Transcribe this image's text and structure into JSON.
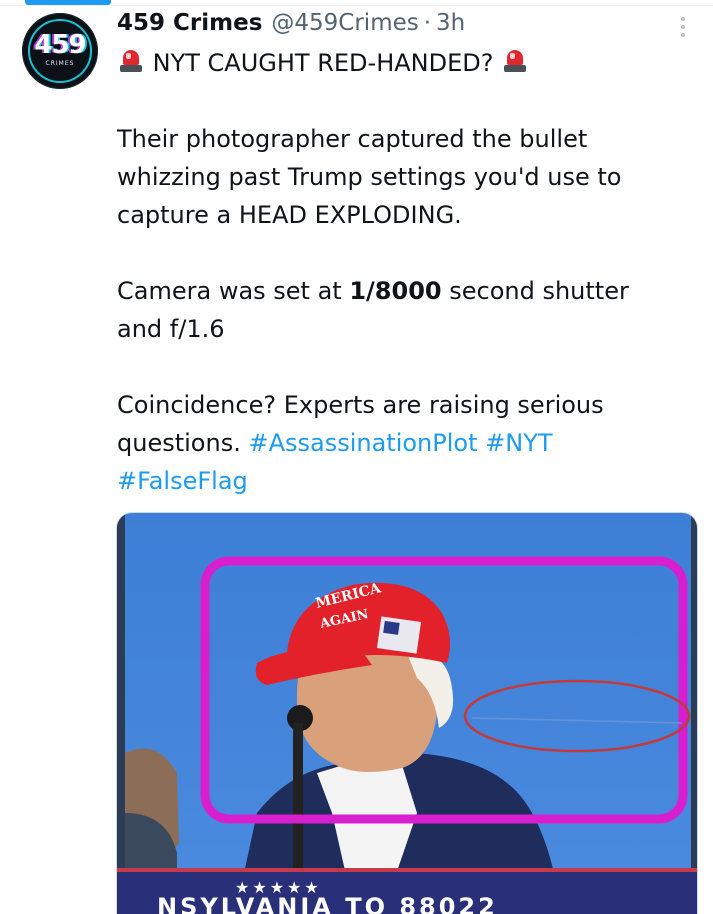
{
  "tweet": {
    "display_name": "459 Crimes",
    "handle": "@459Crimes",
    "separator": "·",
    "time": "3h",
    "avatar": {
      "logo_text": "459",
      "logo_subtext": "CRIMES"
    },
    "icons": {
      "siren": "police-car-light-emoji",
      "more": "more-options-icon"
    },
    "text": {
      "headline": "NYT CAUGHT RED-HANDED?",
      "p1_line1": "Their photographer captured the bullet",
      "p1_line2": "whizzing past Trump settings you'd use to",
      "p1_line3": "capture a HEAD EXPLODING.",
      "p2_pre": "Camera was set at ",
      "p2_bold": "1/8000",
      "p2_post": " second shutter",
      "p2_line2": "and f/1.6",
      "p3_line1": "Coincidence? Experts are raising serious",
      "p3_line2_pre": "questions. ",
      "hashtag_1": "#AssassinationPlot",
      "hashtag_2": "#NYT",
      "hashtag_3": "#FalseFlag"
    },
    "media": {
      "description_icons": [
        "magenta-highlight-rectangle",
        "red-ellipse-annotation"
      ],
      "cap_text_line1": "MERICA",
      "cap_text_line2": "AGAIN",
      "podium_stars": "★★★★★",
      "podium_text": "NSYLVANIA  TO  88022"
    },
    "colors": {
      "link": "#1d9bf0",
      "secondary_text": "#536471",
      "sky": "#3f7fd1",
      "highlight_box": "#d81fd0",
      "annotation_ellipse": "#c23a3a",
      "cap_red": "#e2212b",
      "podium_navy": "#2a2f7a"
    }
  }
}
